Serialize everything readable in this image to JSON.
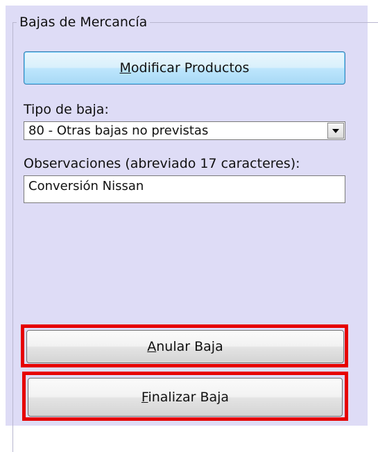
{
  "group": {
    "title": "Bajas de Mercancía"
  },
  "buttons": {
    "modificar": {
      "mnemonic": "M",
      "rest": "odificar Productos"
    },
    "anular": {
      "mnemonic": "A",
      "rest": "nular Baja"
    },
    "finalizar": {
      "mnemonic": "F",
      "rest": "inalizar Baja"
    }
  },
  "tipo_baja": {
    "label": "Tipo de baja:",
    "selected": "80  - Otras bajas no previstas"
  },
  "observaciones": {
    "label": "Observaciones (abreviado 17 caracteres):",
    "value": "Conversión Nissan"
  },
  "icons": {
    "dropdown": "chevron-down-icon"
  },
  "colors": {
    "panel_background": "#dedcf6",
    "highlight": "#e60000",
    "primary_button": "#bee6fd"
  }
}
